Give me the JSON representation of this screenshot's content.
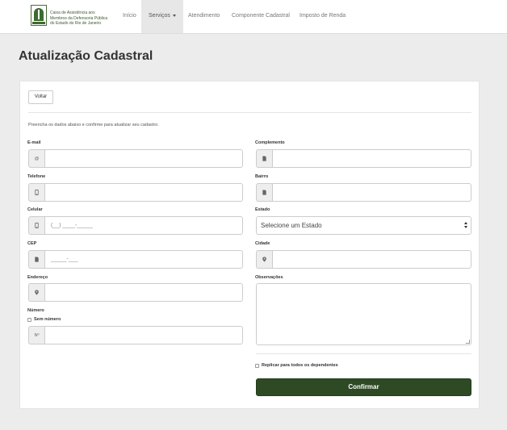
{
  "brand": {
    "lines": [
      "Caixa de Assistência aos",
      "Membros da Defensoria Pública",
      "do Estado do Rio de Janeiro"
    ],
    "mark_text": "CAARJ"
  },
  "nav": {
    "items": [
      {
        "label": "Início"
      },
      {
        "label": "Serviços"
      },
      {
        "label": "Atendimento"
      },
      {
        "label": "Componente Cadastral"
      },
      {
        "label": "Imposto de Renda"
      }
    ],
    "active_index": 1
  },
  "page": {
    "title": "Atualização Cadastral"
  },
  "form": {
    "back_label": "Voltar",
    "intro": "Preencha os dados abaixo e confirme para atualizar seu cadastro.",
    "email": {
      "label": "E-mail",
      "value": "",
      "addon": "@"
    },
    "telefone": {
      "label": "Telefone",
      "value": ""
    },
    "celular": {
      "label": "Celular",
      "placeholder": "(__) ____-_____"
    },
    "cep": {
      "label": "CEP",
      "placeholder": "_____-___"
    },
    "endereco": {
      "label": "Endereço",
      "value": ""
    },
    "numero": {
      "label": "Número",
      "no_number_label": "Sem número",
      "addon": "Nº",
      "value": ""
    },
    "complemento": {
      "label": "Complemento",
      "value": ""
    },
    "bairro": {
      "label": "Bairro",
      "value": ""
    },
    "estado": {
      "label": "Estado",
      "selected": "Selecione um Estado"
    },
    "cidade": {
      "label": "Cidade",
      "value": ""
    },
    "observacoes": {
      "label": "Observações",
      "value": ""
    },
    "replicate_label": "Replicar para todos os dependentes",
    "confirm_label": "Confirmar"
  },
  "colors": {
    "confirm_bg": "#2e4a25",
    "brand_green": "#3c6b2f"
  },
  "icons": {
    "email": "at-icon",
    "telefone": "phone-icon",
    "celular": "mobile-icon",
    "cep": "document-icon",
    "endereco": "map-marker-icon",
    "complemento": "document-icon",
    "bairro": "document-icon",
    "cidade": "map-marker-icon"
  }
}
